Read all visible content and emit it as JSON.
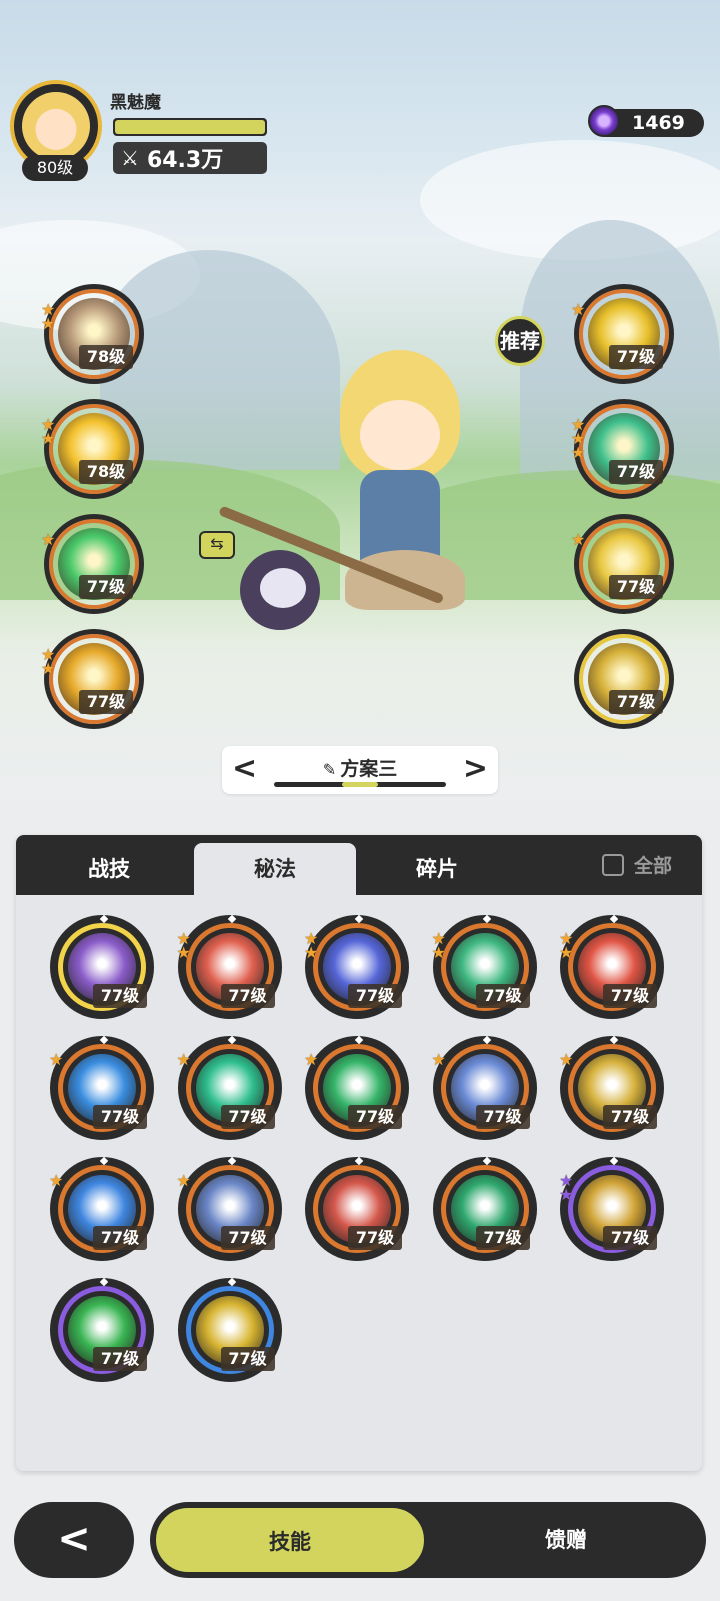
{
  "player": {
    "name": "黑魅魔",
    "level": "80级",
    "power": "64.3万",
    "hp_fraction": 1.0
  },
  "currency": {
    "value": "1469",
    "icon": "purple-gem-icon"
  },
  "recommend_label": "推荐",
  "left_skills": [
    {
      "level": "78级",
      "stars": 2,
      "color": "#b89a7a"
    },
    {
      "level": "78级",
      "stars": 2,
      "color": "#f3c12d"
    },
    {
      "level": "77级",
      "stars": 1,
      "color": "#49c96a"
    },
    {
      "level": "77级",
      "stars": 2,
      "color": "#e6a92a"
    }
  ],
  "right_skills": [
    {
      "level": "77级",
      "stars": 1,
      "color": "#e8c02b",
      "ring": "#d9782e"
    },
    {
      "level": "77级",
      "stars": 3,
      "color": "#3fc08c",
      "ring": "#d9782e"
    },
    {
      "level": "77级",
      "stars": 1,
      "color": "#e8c740",
      "ring": "#d9782e"
    },
    {
      "level": "77级",
      "stars": 0,
      "color": "#d7b23a",
      "ring": "#e8c740"
    }
  ],
  "plan": {
    "label": "方案三",
    "prev": "<",
    "next": ">",
    "edit_icon": "pencil-icon"
  },
  "tabs": [
    {
      "label": "战技",
      "active": false
    },
    {
      "label": "秘法",
      "active": true
    },
    {
      "label": "碎片",
      "active": false
    }
  ],
  "all_toggle": {
    "label": "全部",
    "checked": false
  },
  "grid_skills": [
    {
      "level": "77级",
      "stars": 0,
      "color": "#8a5cc9",
      "ring": "#f2d34a"
    },
    {
      "level": "77级",
      "stars": 2,
      "color": "#e0604f",
      "ring": "#d9782e"
    },
    {
      "level": "77级",
      "stars": 2,
      "color": "#5566d8",
      "ring": "#d9782e"
    },
    {
      "level": "77级",
      "stars": 2,
      "color": "#3fb881",
      "ring": "#d9782e"
    },
    {
      "level": "77级",
      "stars": 2,
      "color": "#e05545",
      "ring": "#d9782e"
    },
    {
      "level": "77级",
      "stars": 1,
      "color": "#3a8de0",
      "ring": "#d9782e"
    },
    {
      "level": "77级",
      "stars": 1,
      "color": "#2fbf8e",
      "ring": "#d9782e"
    },
    {
      "level": "77级",
      "stars": 1,
      "color": "#35b469",
      "ring": "#d9782e"
    },
    {
      "level": "77级",
      "stars": 1,
      "color": "#6b8bd6",
      "ring": "#d9782e"
    },
    {
      "level": "77级",
      "stars": 1,
      "color": "#d6b13c",
      "ring": "#d9782e"
    },
    {
      "level": "77级",
      "stars": 1,
      "color": "#3f86e0",
      "ring": "#d9782e"
    },
    {
      "level": "77级",
      "stars": 1,
      "color": "#6a86c7",
      "ring": "#d9782e"
    },
    {
      "level": "77级",
      "stars": 0,
      "color": "#d4574b",
      "ring": "#d9782e"
    },
    {
      "level": "77级",
      "stars": 0,
      "color": "#2fa86e",
      "ring": "#d9782e"
    },
    {
      "level": "77级",
      "stars": 2,
      "color": "#d1a437",
      "ring": "#8a5cdf",
      "star_color": "purple"
    },
    {
      "level": "77级",
      "stars": 0,
      "color": "#39b452",
      "ring": "#8a5cdf"
    },
    {
      "level": "77级",
      "stars": 0,
      "color": "#d7b431",
      "ring": "#3f86e0"
    }
  ],
  "bottom": {
    "back_icon": "chevron-left-icon",
    "tabs": [
      {
        "label": "技能",
        "active": true
      },
      {
        "label": "馈赠",
        "active": false
      }
    ]
  }
}
